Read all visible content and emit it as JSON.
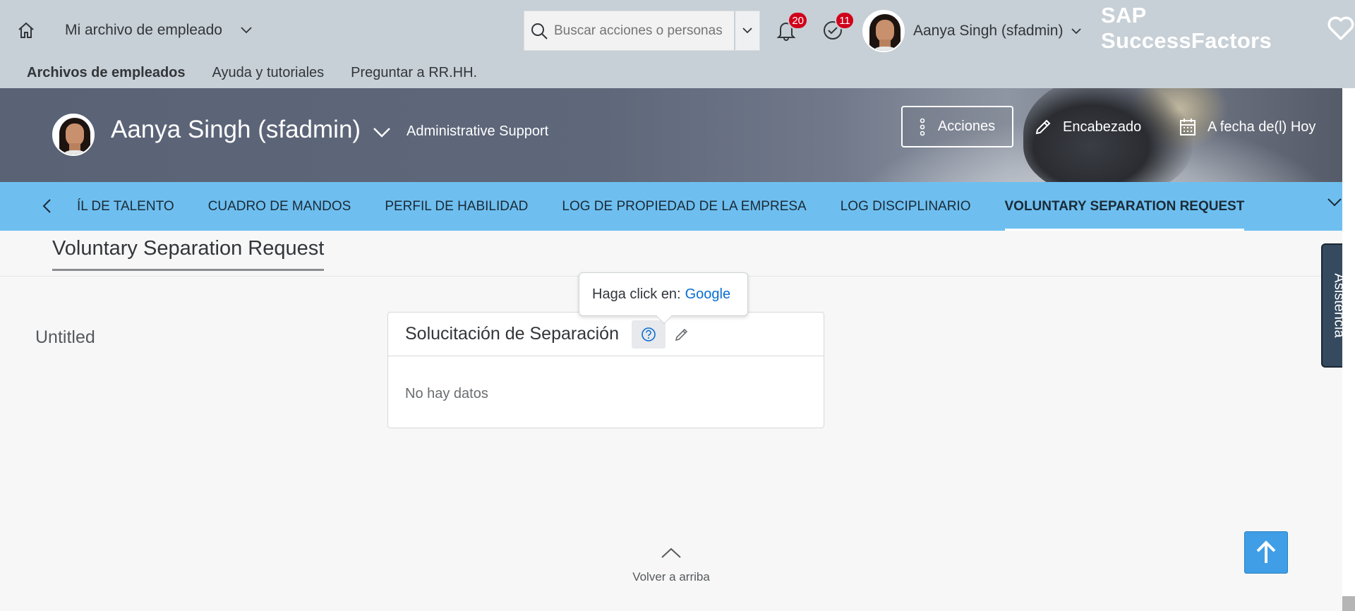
{
  "shell": {
    "module_label": "Mi archivo de empleado",
    "search_placeholder": "Buscar acciones o personas",
    "notifications_count": "20",
    "tasks_count": "11",
    "user_name": "Aanya Singh (sfadmin)",
    "brand": "SAP SuccessFactors"
  },
  "subnav": {
    "items": [
      {
        "label": "Archivos de empleados",
        "active": true
      },
      {
        "label": "Ayuda y tutoriales"
      },
      {
        "label": "Preguntar a RR.HH."
      }
    ]
  },
  "header": {
    "employee_name": "Aanya Singh (sfadmin)",
    "employee_title": "Administrative Support",
    "actions_label": "Acciones",
    "header_label": "Encabezado",
    "as_of_label": "A fecha de(l) Hoy"
  },
  "tabs": {
    "items": [
      {
        "label": "ÍL DE TALENTO"
      },
      {
        "label": "CUADRO DE MANDOS"
      },
      {
        "label": "PERFIL DE HABILIDAD"
      },
      {
        "label": "LOG DE PROPIEDAD DE LA EMPRESA"
      },
      {
        "label": "LOG DISCIPLINARIO"
      },
      {
        "label": "VOLUNTARY SEPARATION REQUEST",
        "active": true
      }
    ]
  },
  "content": {
    "page_title": "Voluntary Separation Request",
    "section_label": "Untitled",
    "card_title": "Solucitación de Separación",
    "no_data": "No hay datos",
    "tooltip_text": "Haga click en:",
    "tooltip_link": "Google",
    "assist_label": "Asistencia",
    "back_to_top": "Volver a arriba"
  },
  "colors": {
    "shell_bg": "#c7d0d6",
    "tab_bg": "#6ebff0",
    "badge": "#d0021b",
    "assist_bg": "#354a5f",
    "fab_bg": "#3f9ee6",
    "link": "#0a6ed1"
  },
  "icons": {
    "home": "home-icon",
    "search": "search-icon",
    "bell": "bell-icon",
    "tasks": "check-circle-icon",
    "heart": "heart-icon",
    "actions": "vertical-dots-icon",
    "edit": "pencil-icon",
    "calendar": "calendar-icon",
    "help": "question-circle-icon",
    "up": "arrow-up-icon"
  }
}
